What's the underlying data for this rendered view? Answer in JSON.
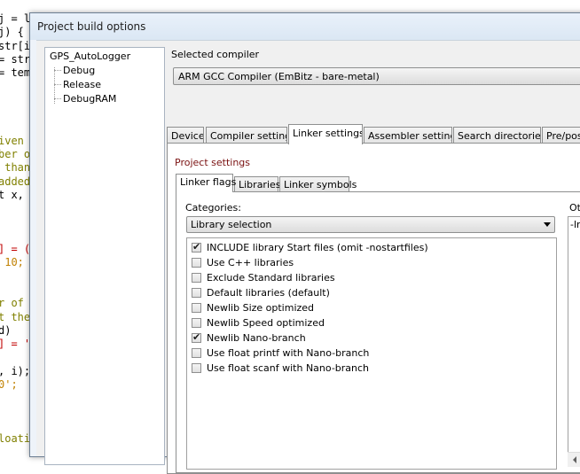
{
  "editor": {
    "code_lines": [
      {
        "text": "j = l",
        "color": "#000000"
      },
      {
        "text": "j) {",
        "color": "#000000"
      },
      {
        "text": "str[i",
        "color": "#000000"
      },
      {
        "text": "= str",
        "color": "#000000"
      },
      {
        "text": "= tem",
        "color": "#000000"
      },
      {
        "text": "",
        "color": "#000000"
      },
      {
        "text": "",
        "color": "#000000"
      },
      {
        "text": "",
        "color": "#000000"
      },
      {
        "text": "",
        "color": "#000000"
      },
      {
        "text": "iven",
        "color": "#808000"
      },
      {
        "text": "ber o",
        "color": "#808000"
      },
      {
        "text": " than",
        "color": "#808000"
      },
      {
        "text": "added",
        "color": "#808000"
      },
      {
        "text": "t x,",
        "color": "#000000"
      },
      {
        "text": "",
        "color": "#000000"
      },
      {
        "text": "",
        "color": "#000000"
      },
      {
        "text": "",
        "color": "#000000"
      },
      {
        "text": "] = (",
        "color": "#c00000"
      },
      {
        "text": " 10;",
        "color": "#c08000"
      },
      {
        "text": "",
        "color": "#000000"
      },
      {
        "text": "",
        "color": "#000000"
      },
      {
        "text": "r of",
        "color": "#808000"
      },
      {
        "text": "t the",
        "color": "#808000"
      },
      {
        "text": "d)",
        "color": "#000000"
      },
      {
        "text": "] = '",
        "color": "#c00000"
      },
      {
        "text": "",
        "color": "#000000"
      },
      {
        "text": ", i);",
        "color": "#000000"
      },
      {
        "text": "0';",
        "color": "#c08000"
      },
      {
        "text": "",
        "color": "#000000"
      },
      {
        "text": "",
        "color": "#000000"
      },
      {
        "text": "",
        "color": "#000000"
      },
      {
        "text": "loati",
        "color": "#808000"
      }
    ]
  },
  "dialog": {
    "title": "Project build options",
    "targets": {
      "project": "GPS_AutoLogger",
      "children": [
        "Debug",
        "Release",
        "DebugRAM"
      ]
    },
    "compiler_label": "Selected compiler",
    "compiler_value": "ARM GCC Compiler (EmBitz - bare-metal)",
    "tabs": [
      "Device",
      "Compiler settings",
      "Linker settings",
      "Assembler settings",
      "Search directories",
      "Pre/post"
    ],
    "active_tab": "Linker settings",
    "project_settings_label": "Project settings",
    "subtabs": [
      "Linker flags",
      "Libraries",
      "Linker symbols"
    ],
    "active_subtab": "Linker flags",
    "categories_label": "Categories:",
    "categories_value": "Library selection",
    "options": [
      {
        "label": "INCLUDE library Start files (omit -nostartfiles)",
        "checked": true
      },
      {
        "label": "Use C++ libraries",
        "checked": false
      },
      {
        "label": "Exclude Standard libraries",
        "checked": false
      },
      {
        "label": "Default libraries (default)",
        "checked": false
      },
      {
        "label": "Newlib Size optimized",
        "checked": false
      },
      {
        "label": "Newlib Speed optimized",
        "checked": false
      },
      {
        "label": "Newlib Nano-branch",
        "checked": true
      },
      {
        "label": "Use float printf with Nano-branch",
        "checked": false
      },
      {
        "label": "Use float scanf  with Nano-branch",
        "checked": false
      }
    ],
    "other_label": "Oth",
    "other_value": "-lm"
  }
}
